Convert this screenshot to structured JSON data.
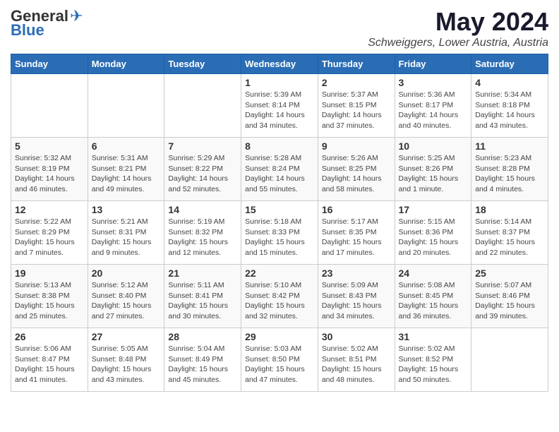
{
  "header": {
    "logo_general": "General",
    "logo_blue": "Blue",
    "month_title": "May 2024",
    "location": "Schweiggers, Lower Austria, Austria"
  },
  "days_of_week": [
    "Sunday",
    "Monday",
    "Tuesday",
    "Wednesday",
    "Thursday",
    "Friday",
    "Saturday"
  ],
  "weeks": [
    [
      {
        "day": "",
        "info": ""
      },
      {
        "day": "",
        "info": ""
      },
      {
        "day": "",
        "info": ""
      },
      {
        "day": "1",
        "info": "Sunrise: 5:39 AM\nSunset: 8:14 PM\nDaylight: 14 hours\nand 34 minutes."
      },
      {
        "day": "2",
        "info": "Sunrise: 5:37 AM\nSunset: 8:15 PM\nDaylight: 14 hours\nand 37 minutes."
      },
      {
        "day": "3",
        "info": "Sunrise: 5:36 AM\nSunset: 8:17 PM\nDaylight: 14 hours\nand 40 minutes."
      },
      {
        "day": "4",
        "info": "Sunrise: 5:34 AM\nSunset: 8:18 PM\nDaylight: 14 hours\nand 43 minutes."
      }
    ],
    [
      {
        "day": "5",
        "info": "Sunrise: 5:32 AM\nSunset: 8:19 PM\nDaylight: 14 hours\nand 46 minutes."
      },
      {
        "day": "6",
        "info": "Sunrise: 5:31 AM\nSunset: 8:21 PM\nDaylight: 14 hours\nand 49 minutes."
      },
      {
        "day": "7",
        "info": "Sunrise: 5:29 AM\nSunset: 8:22 PM\nDaylight: 14 hours\nand 52 minutes."
      },
      {
        "day": "8",
        "info": "Sunrise: 5:28 AM\nSunset: 8:24 PM\nDaylight: 14 hours\nand 55 minutes."
      },
      {
        "day": "9",
        "info": "Sunrise: 5:26 AM\nSunset: 8:25 PM\nDaylight: 14 hours\nand 58 minutes."
      },
      {
        "day": "10",
        "info": "Sunrise: 5:25 AM\nSunset: 8:26 PM\nDaylight: 15 hours\nand 1 minute."
      },
      {
        "day": "11",
        "info": "Sunrise: 5:23 AM\nSunset: 8:28 PM\nDaylight: 15 hours\nand 4 minutes."
      }
    ],
    [
      {
        "day": "12",
        "info": "Sunrise: 5:22 AM\nSunset: 8:29 PM\nDaylight: 15 hours\nand 7 minutes."
      },
      {
        "day": "13",
        "info": "Sunrise: 5:21 AM\nSunset: 8:31 PM\nDaylight: 15 hours\nand 9 minutes."
      },
      {
        "day": "14",
        "info": "Sunrise: 5:19 AM\nSunset: 8:32 PM\nDaylight: 15 hours\nand 12 minutes."
      },
      {
        "day": "15",
        "info": "Sunrise: 5:18 AM\nSunset: 8:33 PM\nDaylight: 15 hours\nand 15 minutes."
      },
      {
        "day": "16",
        "info": "Sunrise: 5:17 AM\nSunset: 8:35 PM\nDaylight: 15 hours\nand 17 minutes."
      },
      {
        "day": "17",
        "info": "Sunrise: 5:15 AM\nSunset: 8:36 PM\nDaylight: 15 hours\nand 20 minutes."
      },
      {
        "day": "18",
        "info": "Sunrise: 5:14 AM\nSunset: 8:37 PM\nDaylight: 15 hours\nand 22 minutes."
      }
    ],
    [
      {
        "day": "19",
        "info": "Sunrise: 5:13 AM\nSunset: 8:38 PM\nDaylight: 15 hours\nand 25 minutes."
      },
      {
        "day": "20",
        "info": "Sunrise: 5:12 AM\nSunset: 8:40 PM\nDaylight: 15 hours\nand 27 minutes."
      },
      {
        "day": "21",
        "info": "Sunrise: 5:11 AM\nSunset: 8:41 PM\nDaylight: 15 hours\nand 30 minutes."
      },
      {
        "day": "22",
        "info": "Sunrise: 5:10 AM\nSunset: 8:42 PM\nDaylight: 15 hours\nand 32 minutes."
      },
      {
        "day": "23",
        "info": "Sunrise: 5:09 AM\nSunset: 8:43 PM\nDaylight: 15 hours\nand 34 minutes."
      },
      {
        "day": "24",
        "info": "Sunrise: 5:08 AM\nSunset: 8:45 PM\nDaylight: 15 hours\nand 36 minutes."
      },
      {
        "day": "25",
        "info": "Sunrise: 5:07 AM\nSunset: 8:46 PM\nDaylight: 15 hours\nand 39 minutes."
      }
    ],
    [
      {
        "day": "26",
        "info": "Sunrise: 5:06 AM\nSunset: 8:47 PM\nDaylight: 15 hours\nand 41 minutes."
      },
      {
        "day": "27",
        "info": "Sunrise: 5:05 AM\nSunset: 8:48 PM\nDaylight: 15 hours\nand 43 minutes."
      },
      {
        "day": "28",
        "info": "Sunrise: 5:04 AM\nSunset: 8:49 PM\nDaylight: 15 hours\nand 45 minutes."
      },
      {
        "day": "29",
        "info": "Sunrise: 5:03 AM\nSunset: 8:50 PM\nDaylight: 15 hours\nand 47 minutes."
      },
      {
        "day": "30",
        "info": "Sunrise: 5:02 AM\nSunset: 8:51 PM\nDaylight: 15 hours\nand 48 minutes."
      },
      {
        "day": "31",
        "info": "Sunrise: 5:02 AM\nSunset: 8:52 PM\nDaylight: 15 hours\nand 50 minutes."
      },
      {
        "day": "",
        "info": ""
      }
    ]
  ]
}
